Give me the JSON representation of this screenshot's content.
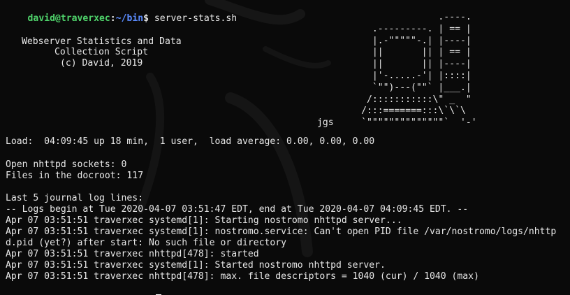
{
  "prompt": {
    "user_host": "david@traverxec",
    "separator": ":",
    "path": "~/bin",
    "dollar": "$",
    "command": " server-stats.sh"
  },
  "banner": {
    "line1": "Webserver Statistics and Data",
    "line2": "Collection Script",
    "line3": "(c) David, 2019"
  },
  "ascii_art": "                      .----.\n          .---------. | == |\n          |.-\"\"\"\"\"-.| |----|\n          ||       || | == |\n          ||       || |----|\n          |'-.....-'| |::::|\n          `\"\")---(\"\"` |___.|\n         /:::::::::::\\\" _  \"\n        /:::=======:::\\`\\`\\\njgs     `\"\"\"\"\"\"\"\"\"\"\"\"\"\"`  '-'",
  "output": {
    "load": "Load:  04:09:45 up 18 min,  1 user,  load average: 0.00, 0.00, 0.00",
    "sockets": "Open nhttpd sockets: 0",
    "files": "Files in the docroot: 117",
    "journal_header": "Last 5 journal log lines:",
    "logs": [
      "-- Logs begin at Tue 2020-04-07 03:51:47 EDT, end at Tue 2020-04-07 04:09:45 EDT. --",
      "Apr 07 03:51:51 traverxec systemd[1]: Starting nostromo nhttpd server...",
      "Apr 07 03:51:51 traverxec systemd[1]: nostromo.service: Can't open PID file /var/nostromo/logs/nhttp",
      "d.pid (yet?) after start: No such file or directory",
      "Apr 07 03:51:51 traverxec nhttpd[478]: started",
      "Apr 07 03:51:51 traverxec systemd[1]: Started nostromo nhttpd server.",
      "Apr 07 03:51:51 traverxec nhttpd[478]: max. file descriptors = 1040 (cur) / 1040 (max)"
    ]
  },
  "colors": {
    "background": "#0a0a0a",
    "text": "#e8e8e8",
    "user_host": "#4fd36b",
    "path": "#5b8cff"
  }
}
